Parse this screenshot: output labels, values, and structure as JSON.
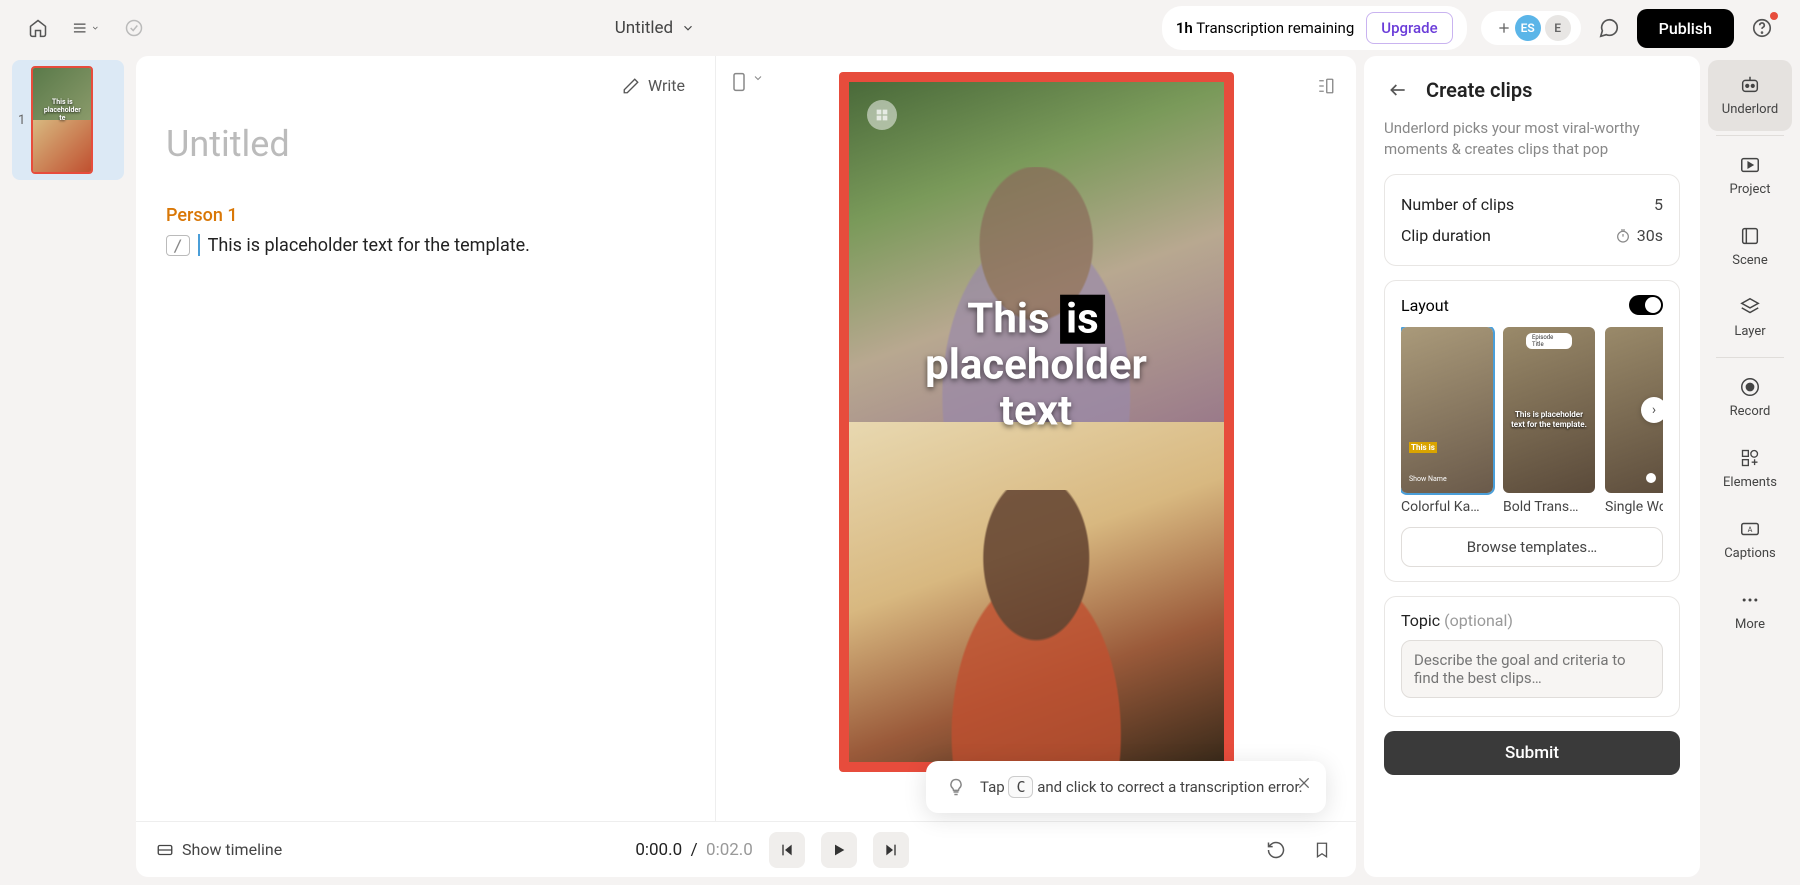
{
  "topbar": {
    "title": "Untitled",
    "transcription_prefix": "1h",
    "transcription_label": "Transcription remaining",
    "upgrade": "Upgrade",
    "avatar1": "ES",
    "avatar2": "E",
    "publish": "Publish"
  },
  "scene": {
    "number": "1",
    "thumb_caption": "This is placeholder te"
  },
  "script": {
    "write": "Write",
    "doc_title": "Untitled",
    "speaker": "Person 1",
    "line": "This is placeholder text for the template."
  },
  "preview": {
    "caption_line1": "This is",
    "caption_word_hl": "is",
    "caption_line2": "placeholder text"
  },
  "tip": {
    "prefix": "Tap",
    "key": "C",
    "suffix": "and click to correct a transcription error."
  },
  "transport": {
    "show_timeline": "Show timeline",
    "current": "0:00.0",
    "sep": "/",
    "duration": "0:02.0"
  },
  "panel": {
    "title": "Create clips",
    "desc": "Underlord picks your most viral-worthy moments & creates clips that pop",
    "num_clips_label": "Number of clips",
    "num_clips_value": "5",
    "duration_label": "Clip duration",
    "duration_value": "30s",
    "layout_label": "Layout",
    "templates": [
      {
        "name": "Colorful Ka…"
      },
      {
        "name": "Bold Trans…"
      },
      {
        "name": "Single Word"
      }
    ],
    "template_tt1_label": "This",
    "template_tt1_sub": "Show Name",
    "template_tt2_header": "Episode Title",
    "template_tt2_text": "This is placeholder text for the template.",
    "browse": "Browse templates…",
    "topic_label": "Topic",
    "topic_optional": "(optional)",
    "topic_placeholder": "Describe the goal and criteria to find the best clips…",
    "submit": "Submit"
  },
  "rail": {
    "items": [
      "Underlord",
      "Project",
      "Scene",
      "Layer",
      "Record",
      "Elements",
      "Captions",
      "More"
    ]
  }
}
